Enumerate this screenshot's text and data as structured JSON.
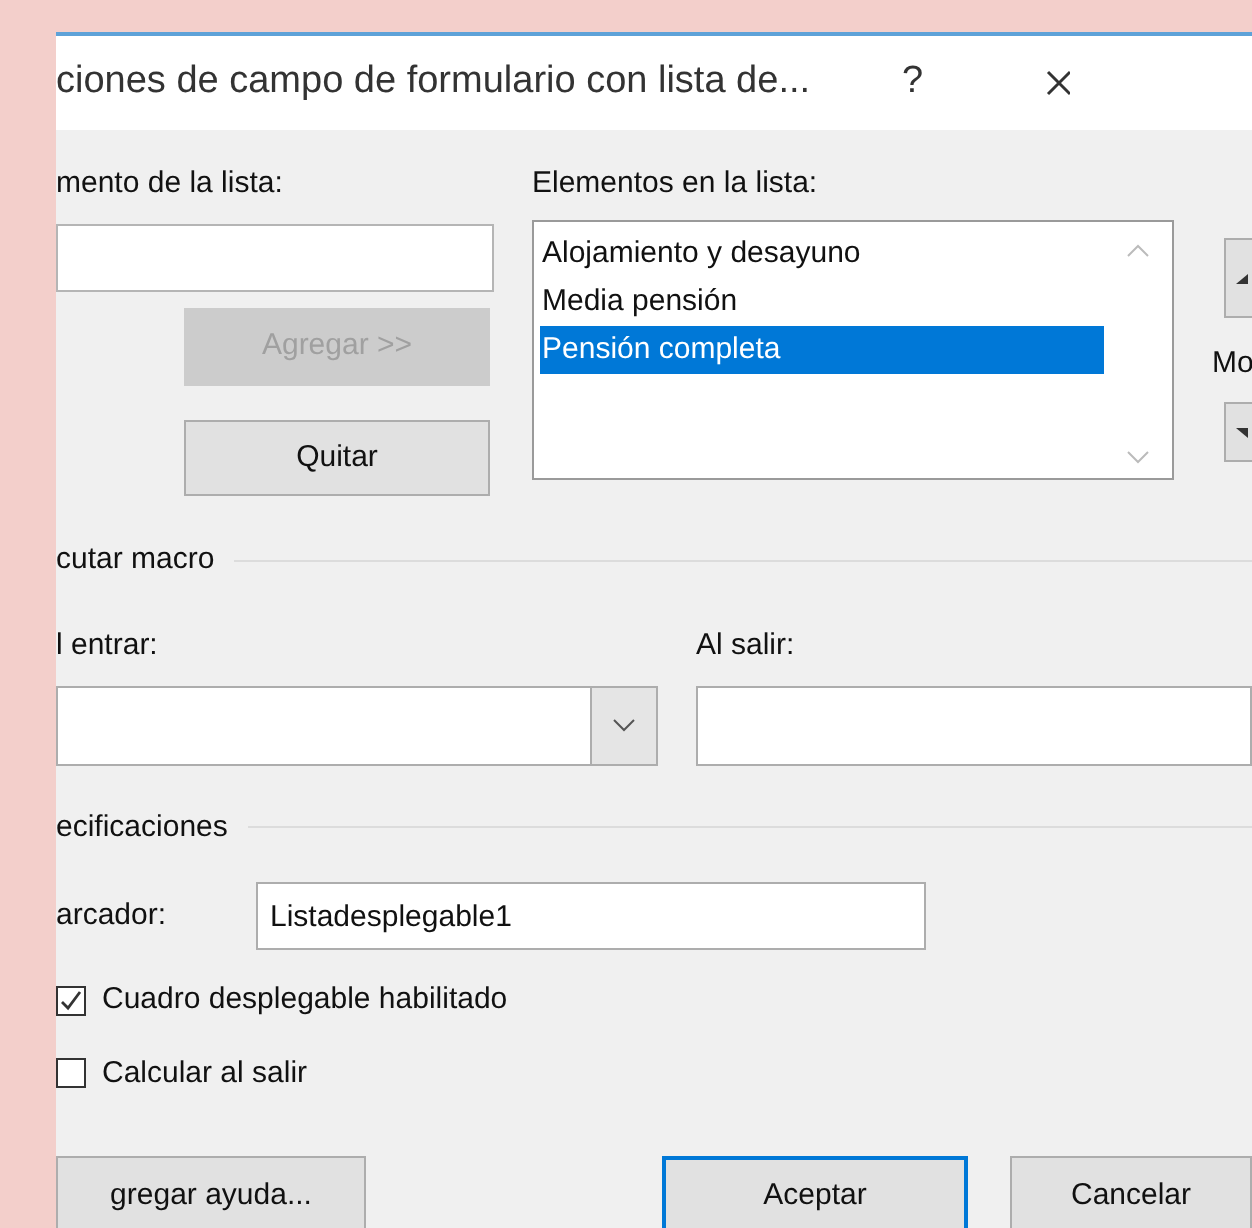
{
  "title_bar": {
    "title": "ciones de campo de formulario con lista de...",
    "help": "?"
  },
  "list_editor": {
    "item_label": "mento de la lista:",
    "add_button": {
      "label": "Agregar >>",
      "disabled": true
    },
    "remove_button": {
      "label": "Quitar",
      "disabled": false
    },
    "list_label": "Elementos en la lista:",
    "items": [
      {
        "label": "Alojamiento y desayuno",
        "selected": false
      },
      {
        "label": "Media pensión",
        "selected": false
      },
      {
        "label": "Pensión completa",
        "selected": true
      }
    ],
    "move_label": "Mo"
  },
  "macro_group": {
    "title": "cutar macro",
    "on_entry_label": "l entrar:",
    "on_exit_label": "Al salir:"
  },
  "settings_group": {
    "title": "ecificaciones",
    "bookmark_label": "arcador:",
    "bookmark_value": "Listadesplegable1",
    "checkboxes": [
      {
        "label": "Cuadro desplegable habilitado",
        "checked": true
      },
      {
        "label": "Calcular al salir",
        "checked": false
      }
    ]
  },
  "buttons": [
    {
      "label": "gregar ayuda...",
      "default": false
    },
    {
      "label": "Aceptar",
      "default": true
    },
    {
      "label": "Cancelar",
      "default": false
    }
  ]
}
